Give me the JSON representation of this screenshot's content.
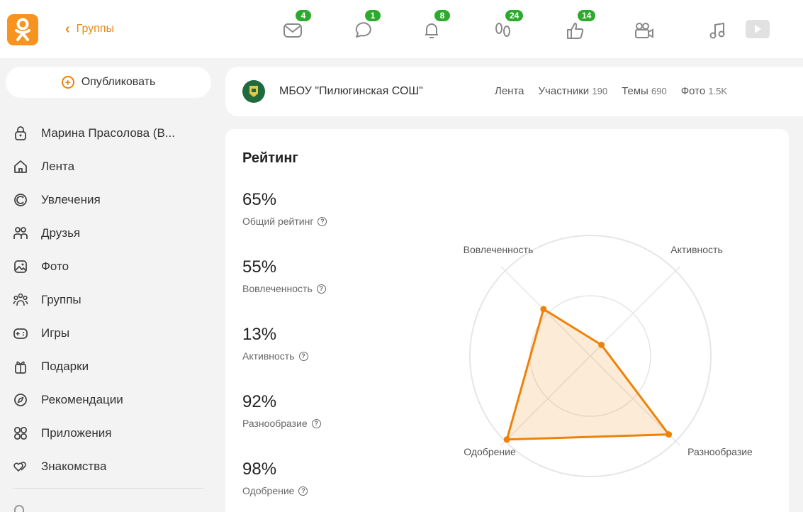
{
  "header": {
    "back_label": "Группы",
    "badges": {
      "messages": "4",
      "discussions": "1",
      "notifications": "8",
      "guests": "24",
      "events": "14"
    }
  },
  "sidebar": {
    "publish_label": "Опубликовать",
    "items": [
      {
        "label": "Марина Прасолова (В...",
        "icon": "user-icon"
      },
      {
        "label": "Лента",
        "icon": "home-icon"
      },
      {
        "label": "Увлечения",
        "icon": "hobby-icon"
      },
      {
        "label": "Друзья",
        "icon": "friends-icon"
      },
      {
        "label": "Фото",
        "icon": "photo-icon"
      },
      {
        "label": "Группы",
        "icon": "groups-icon"
      },
      {
        "label": "Игры",
        "icon": "gamepad-icon"
      },
      {
        "label": "Подарки",
        "icon": "gift-icon"
      },
      {
        "label": "Рекомендации",
        "icon": "compass-icon"
      },
      {
        "label": "Приложения",
        "icon": "apps-icon"
      },
      {
        "label": "Знакомства",
        "icon": "hearts-icon"
      }
    ]
  },
  "group": {
    "name": "МБОУ \"Пилюгинская СОШ\"",
    "tabs": [
      {
        "label": "Лента",
        "count": ""
      },
      {
        "label": "Участники",
        "count": "190"
      },
      {
        "label": "Темы",
        "count": "690"
      },
      {
        "label": "Фото",
        "count": "1.5K"
      }
    ]
  },
  "rating": {
    "title": "Рейтинг",
    "metrics": [
      {
        "value": "65%",
        "label": "Общий рейтинг"
      },
      {
        "value": "55%",
        "label": "Вовлеченность"
      },
      {
        "value": "13%",
        "label": "Активность"
      },
      {
        "value": "92%",
        "label": "Разнообразие"
      },
      {
        "value": "98%",
        "label": "Одобрение"
      }
    ]
  },
  "chart_data": {
    "type": "radar",
    "axes": [
      "Активность",
      "Разнообразие",
      "Одобрение",
      "Вовлеченность"
    ],
    "values": [
      13,
      92,
      98,
      55
    ],
    "range": [
      0,
      100
    ],
    "color": "#ee8208"
  },
  "colors": {
    "accent": "#ee8208",
    "badge": "#2daa2d"
  }
}
